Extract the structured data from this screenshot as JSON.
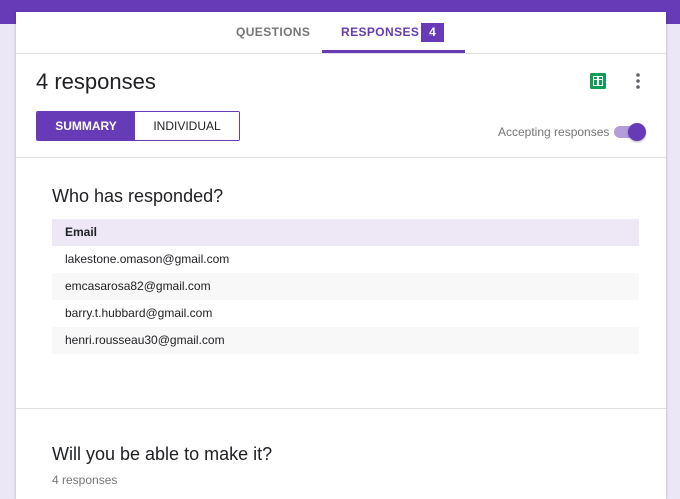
{
  "tabs": {
    "questions_label": "QUESTIONS",
    "responses_label": "RESPONSES",
    "responses_count": "4"
  },
  "header": {
    "title": "4 responses",
    "sheets_icon": "google-sheets-icon",
    "more_icon": "more-vert-icon"
  },
  "view_toggle": {
    "summary_label": "SUMMARY",
    "individual_label": "INDIVIDUAL",
    "selected": "SUMMARY"
  },
  "accepting": {
    "label": "Accepting responses",
    "enabled": true
  },
  "who_responded": {
    "title": "Who has responded?",
    "column_header": "Email",
    "emails": [
      "lakestone.omason@gmail.com",
      "emcasarosa82@gmail.com",
      "barry.t.hubbard@gmail.com",
      "henri.rousseau30@gmail.com"
    ]
  },
  "question": {
    "title": "Will you be able to make it?",
    "count_text": "4 responses"
  },
  "colors": {
    "accent": "#673ab7",
    "background": "#ece7f6",
    "table_header_bg": "#ede7f6",
    "sheets_green": "#0f9d58"
  }
}
